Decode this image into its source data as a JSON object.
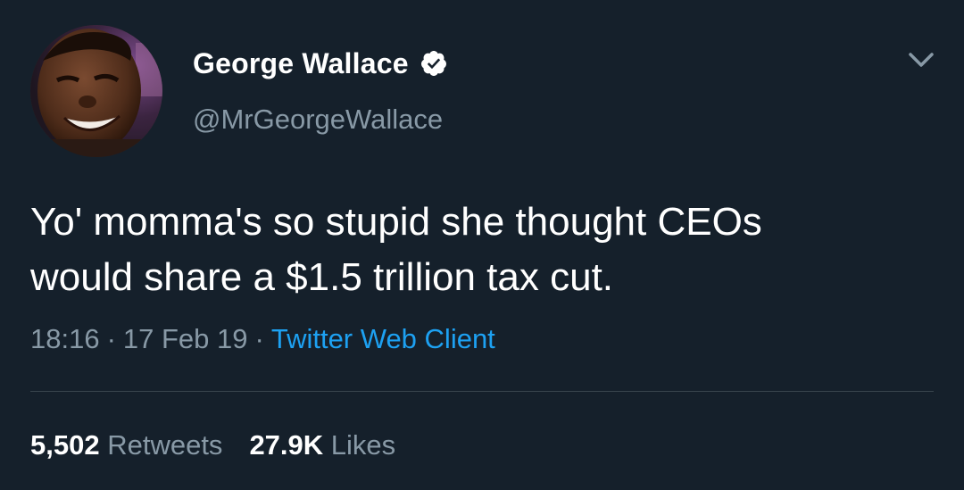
{
  "colors": {
    "background": "#15202b",
    "text_primary": "#ffffff",
    "text_secondary": "#8899a6",
    "link": "#1da1f2",
    "divider": "#38444d"
  },
  "author": {
    "display_name": "George Wallace",
    "handle": "@MrGeorgeWallace",
    "verified_icon": "verified-badge-icon",
    "avatar_icon": "profile-photo"
  },
  "menu_icon": "chevron-down-icon",
  "tweet": {
    "text": "Yo' momma's so stupid she thought CEOs\nwould share a $1.5 trillion tax cut.",
    "time": "18:16",
    "separator": "·",
    "date": "17 Feb 19",
    "client": "Twitter Web Client"
  },
  "stats": {
    "retweets_count": "5,502",
    "retweets_label": "Retweets",
    "likes_count": "27.9K",
    "likes_label": "Likes"
  }
}
